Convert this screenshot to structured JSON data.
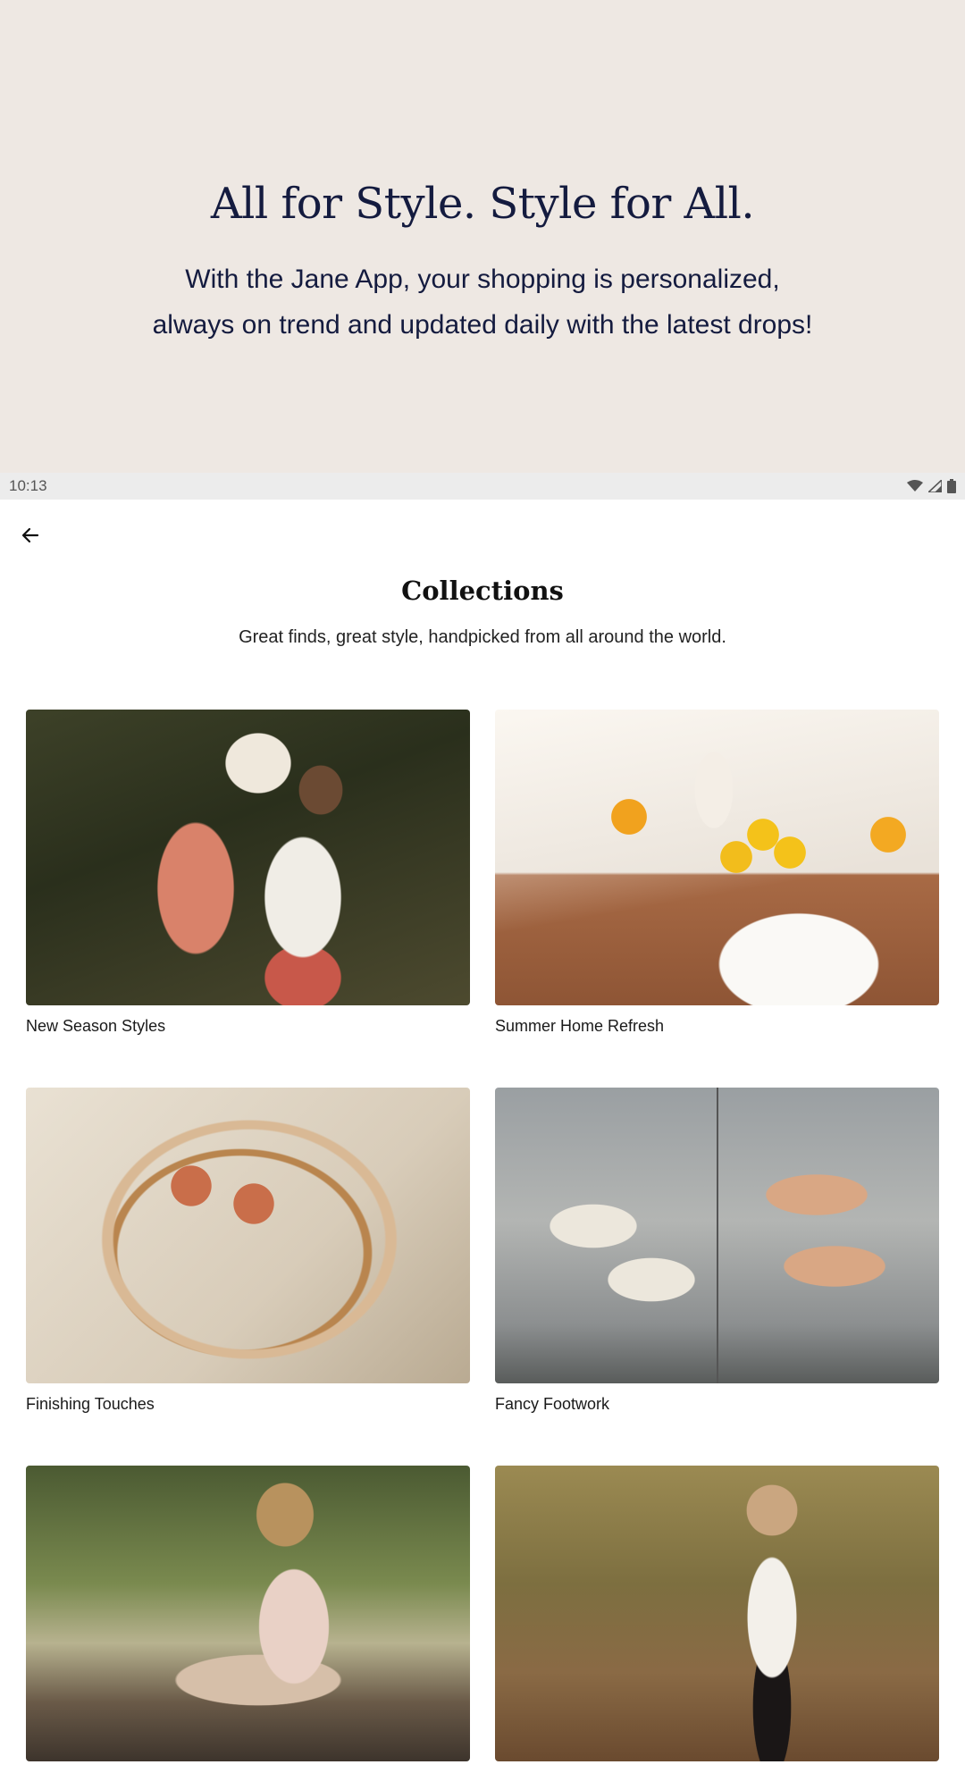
{
  "hero": {
    "headline": "All for Style. Style for All.",
    "body_line1": "With the Jane App, your shopping is personalized,",
    "body_line2": "always on trend and updated daily with the latest drops!"
  },
  "status_bar": {
    "time": "10:13",
    "icons": [
      "wifi-icon",
      "cell-signal-icon",
      "battery-icon"
    ]
  },
  "header": {
    "back_icon": "arrow-left-icon",
    "title": "Collections",
    "subtitle": "Great finds, great style, handpicked from all around the world."
  },
  "collections": [
    {
      "label": "New Season Styles"
    },
    {
      "label": "Summer Home Refresh"
    },
    {
      "label": "Finishing Touches"
    },
    {
      "label": "Fancy Footwork"
    },
    {
      "label": ""
    },
    {
      "label": ""
    }
  ],
  "colors": {
    "hero_bg": "#eee8e3",
    "hero_text": "#141b3f",
    "status_bar_bg": "#ececec"
  }
}
